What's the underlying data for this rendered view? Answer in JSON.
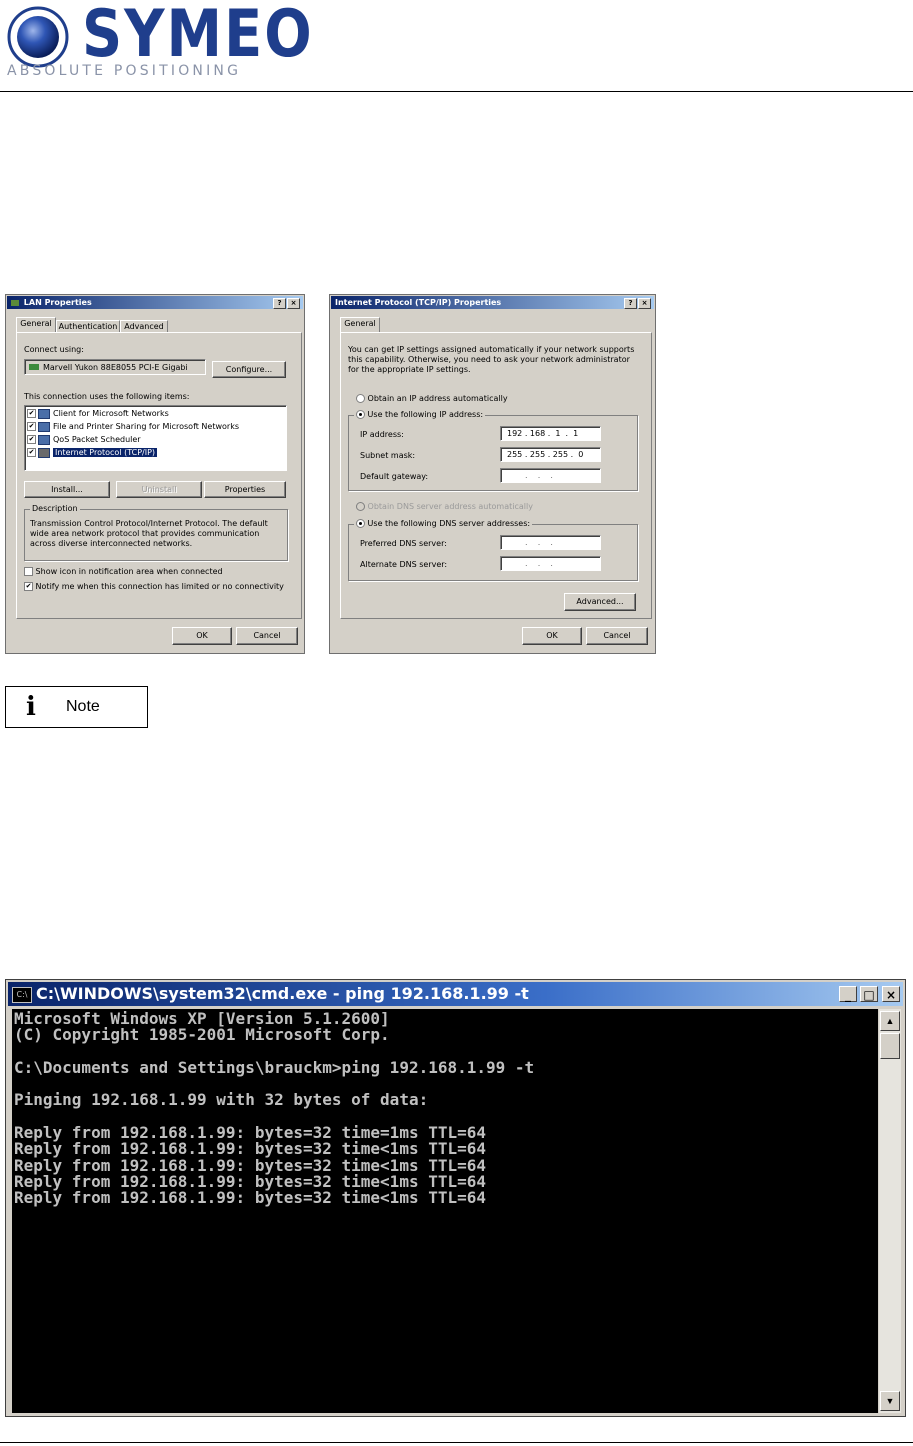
{
  "header": {
    "logo_word": "SYMEO",
    "logo_tagline": "ABSOLUTE POSITIONING",
    "brand_color": "#1f3e8c"
  },
  "lan_dialog": {
    "title": "LAN Properties",
    "title_buttons": [
      "?",
      "×"
    ],
    "tabs": [
      "General",
      "Authentication",
      "Advanced"
    ],
    "connect_using_label": "Connect using:",
    "adapter": "Marvell Yukon 88E8055 PCI-E Gigabi",
    "configure_button": "Configure...",
    "items_label": "This connection uses the following items:",
    "items": [
      {
        "label": "Client for Microsoft Networks",
        "checked": true
      },
      {
        "label": "File and Printer Sharing for Microsoft Networks",
        "checked": true
      },
      {
        "label": "QoS Packet Scheduler",
        "checked": true
      },
      {
        "label": "Internet Protocol (TCP/IP)",
        "checked": true
      }
    ],
    "install_button": "Install...",
    "uninstall_button": "Uninstall",
    "properties_button": "Properties",
    "description_label": "Description",
    "description_text": "Transmission Control Protocol/Internet Protocol. The default wide area network protocol that provides communication across diverse interconnected networks.",
    "show_icon_label": "Show icon in notification area when connected",
    "notify_label": "Notify me when this connection has limited or no connectivity",
    "ok_button": "OK",
    "cancel_button": "Cancel"
  },
  "tcp_dialog": {
    "title": "Internet Protocol (TCP/IP) Properties",
    "title_buttons": [
      "?",
      "×"
    ],
    "tab": "General",
    "intro": "You can get IP settings assigned automatically if your network supports this capability. Otherwise, you need to ask your network administrator for the appropriate IP settings.",
    "obtain_auto_ip": "Obtain an IP address automatically",
    "use_following_ip": "Use the following IP address:",
    "ip_address_label": "IP address:",
    "ip_address": "192 . 168 .  1  .  1",
    "subnet_label": "Subnet mask:",
    "subnet": "255 . 255 . 255 .  0",
    "gateway_label": "Default gateway:",
    "gateway": ".    .    .",
    "obtain_dns_auto": "Obtain DNS server address automatically",
    "use_following_dns": "Use the following DNS server addresses:",
    "preferred_dns_label": "Preferred DNS server:",
    "preferred_dns": ".    .    .",
    "alternate_dns_label": "Alternate DNS server:",
    "alternate_dns": ".    .    .",
    "advanced_button": "Advanced...",
    "ok_button": "OK",
    "cancel_button": "Cancel"
  },
  "note": {
    "icon": "i",
    "label": "Note"
  },
  "cmd_window": {
    "icon_text": "C:\\",
    "title": "C:\\WINDOWS\\system32\\cmd.exe - ping 192.168.1.99 -t",
    "min_symbol": "_",
    "max_symbol": "□",
    "close_symbol": "×",
    "lines": [
      "Microsoft Windows XP [Version 5.1.2600]",
      "(C) Copyright 1985-2001 Microsoft Corp.",
      "",
      "C:\\Documents and Settings\\brauckm>ping 192.168.1.99 -t",
      "",
      "Pinging 192.168.1.99 with 32 bytes of data:",
      "",
      "Reply from 192.168.1.99: bytes=32 time=1ms TTL=64",
      "Reply from 192.168.1.99: bytes=32 time<1ms TTL=64",
      "Reply from 192.168.1.99: bytes=32 time<1ms TTL=64",
      "Reply from 192.168.1.99: bytes=32 time<1ms TTL=64",
      "Reply from 192.168.1.99: bytes=32 time<1ms TTL=64"
    ],
    "scroll_up": "▲",
    "scroll_down": "▼"
  }
}
